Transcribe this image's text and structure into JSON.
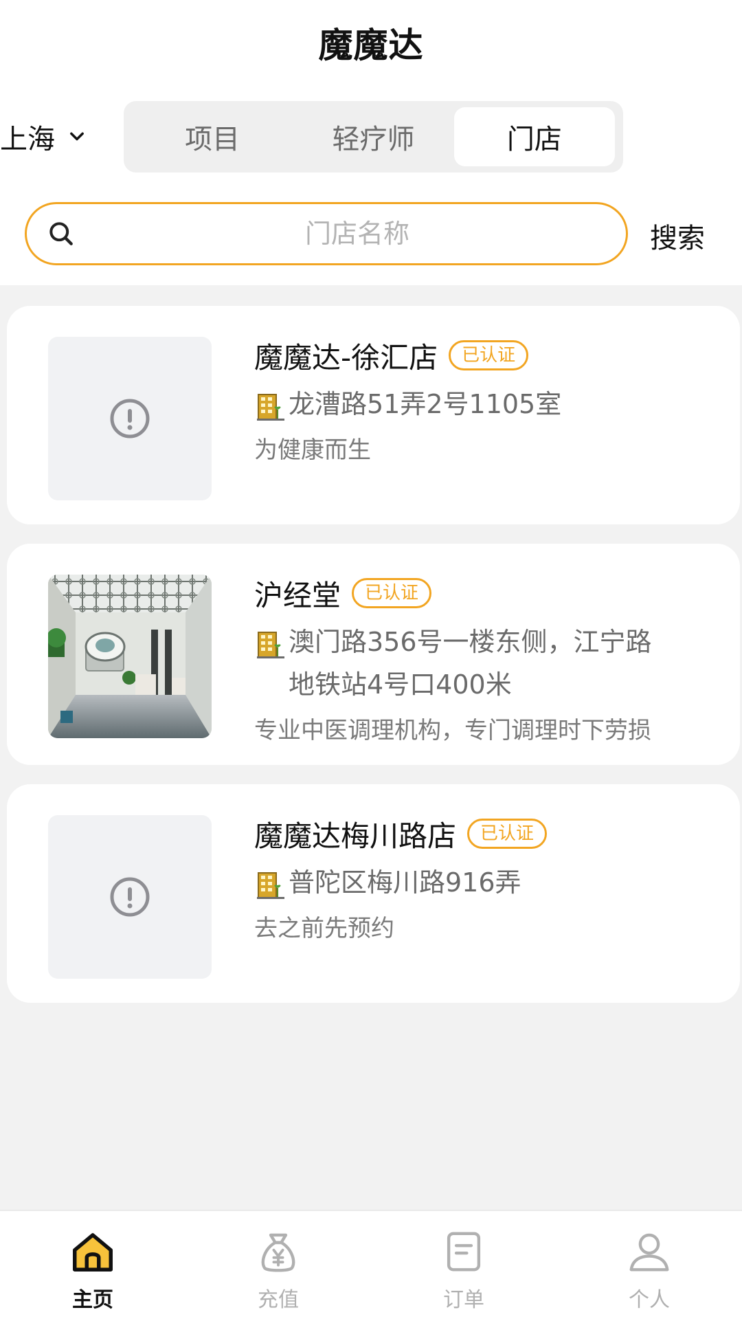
{
  "header": {
    "title": "魔魔达",
    "city": "上海",
    "tabs": [
      {
        "label": "项目",
        "active": false
      },
      {
        "label": "轻疗师",
        "active": false
      },
      {
        "label": "门店",
        "active": true
      }
    ]
  },
  "search": {
    "placeholder": "门店名称",
    "button_label": "搜索"
  },
  "stores": [
    {
      "name": "魔魔达-徐汇店",
      "badge": "已认证",
      "address_line1": "龙漕路51弄2号1105室",
      "address_line2": "",
      "desc": "为健康而生",
      "image": "placeholder"
    },
    {
      "name": "沪经堂",
      "badge": "已认证",
      "address_line1": "澳门路356号一楼东侧，江宁路",
      "address_line2": "地铁站4号口400米",
      "desc": "专业中医调理机构，专门调理时下劳损",
      "image": "interior-photo"
    },
    {
      "name": "魔魔达梅川路店",
      "badge": "已认证",
      "address_line1": "普陀区梅川路916弄",
      "address_line2": "",
      "desc": "去之前先预约",
      "image": "placeholder"
    }
  ],
  "tabbar": {
    "items": [
      {
        "label": "主页",
        "icon": "home-icon",
        "active": true
      },
      {
        "label": "充值",
        "icon": "money-bag-icon",
        "active": false
      },
      {
        "label": "订单",
        "icon": "order-icon",
        "active": false
      },
      {
        "label": "个人",
        "icon": "user-icon",
        "active": false
      }
    ]
  },
  "colors": {
    "accent": "#f2a521",
    "active_tab_fill": "#f7c23b",
    "text_primary": "#111111",
    "text_secondary": "#6a6a6a",
    "background": "#f2f2f2"
  }
}
